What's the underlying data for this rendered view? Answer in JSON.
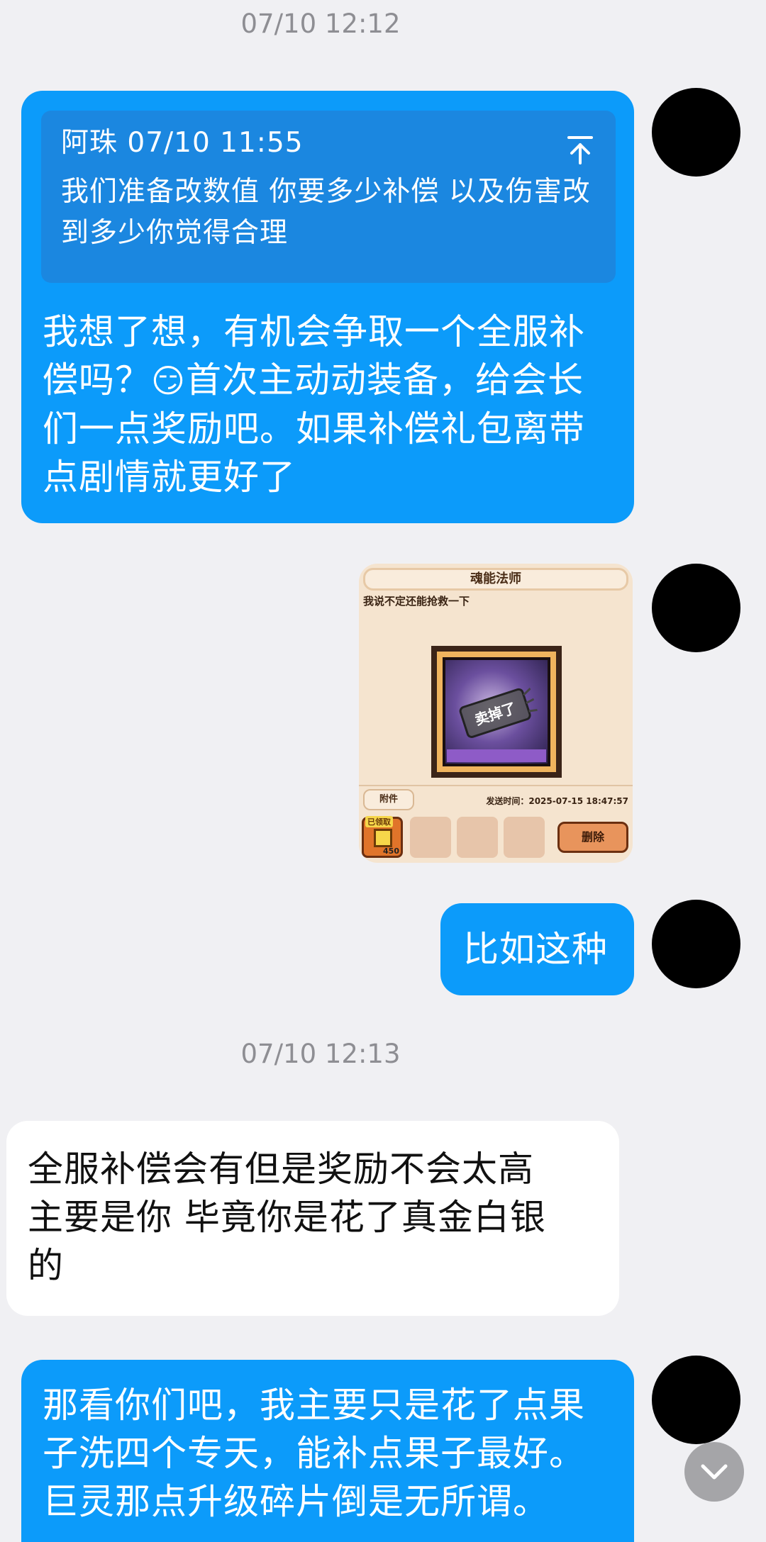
{
  "timestamps": [
    "07/10 12:12",
    "07/10 12:13"
  ],
  "messages": {
    "m1": {
      "quote": {
        "author_time": "阿珠 07/10 11:55",
        "body": "我们准备改数值  你要多少补偿 以及伤害改到多少你觉得合理"
      },
      "line1": "我想了想，有机会争取一个全服补",
      "line2_a": "偿吗？",
      "emoji": "😏",
      "line2_b": "首次主动动装备，给会长",
      "line3": "们一点奖励吧。如果补偿礼包离带",
      "line4": "点剧情就更好了"
    },
    "m2": {
      "game": {
        "title": "魂能法师",
        "note": "我说不定还能抢救一下",
        "stamp": "卖掉了",
        "attach": "附件",
        "sent": "发送时间：2025-07-15 18:47:57",
        "claimed": "已领取",
        "qty": "450",
        "delete": "删除"
      }
    },
    "m3": {
      "text": "比如这种"
    },
    "m4": {
      "line1": "全服补偿会有但是奖励不会太高",
      "line2": "主要是你  毕竟你是花了真金白银",
      "line3": "的"
    },
    "m5": {
      "line1": "那看你们吧，我主要只是花了点果",
      "line2": "子洗四个专天，能补点果子最好。",
      "line3": "巨灵那点升级碎片倒是无所谓。"
    }
  },
  "colors": {
    "outgoing": "#0c9bfa",
    "quote_bg": "#1b87e0",
    "incoming": "#ffffff",
    "background": "#f0f0f3",
    "avatar": "#000000"
  },
  "icons": {
    "quote_jump": "arrow-up-to-top-icon",
    "scroll": "chevron-down-icon"
  }
}
